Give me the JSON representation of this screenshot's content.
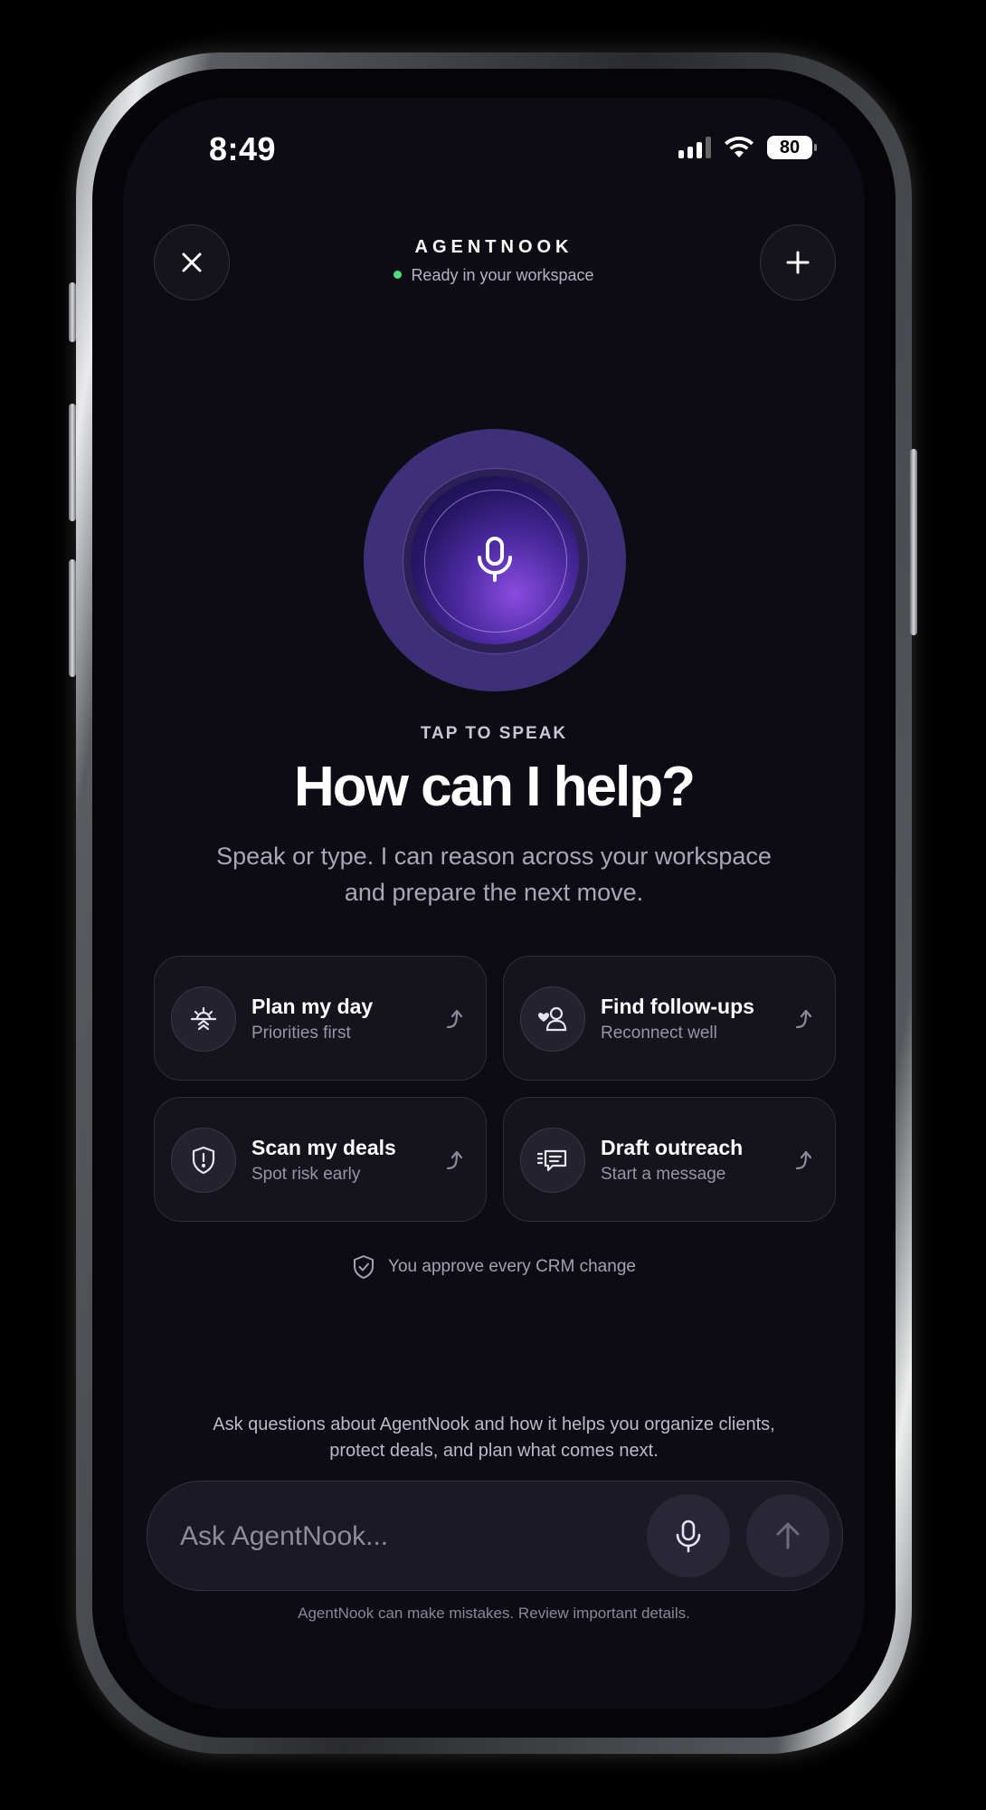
{
  "status_bar": {
    "time": "8:49",
    "battery": "80"
  },
  "header": {
    "title": "AGENTNOOK",
    "status": "Ready in your workspace"
  },
  "voice": {
    "tap_label": "TAP TO SPEAK"
  },
  "hero": {
    "headline": "How can I help?",
    "subtitle": "Speak or type. I can reason across your workspace and prepare the next move."
  },
  "suggestions": [
    {
      "title": "Plan my day",
      "subtitle": "Priorities first",
      "icon": "sunrise-icon"
    },
    {
      "title": "Find follow-ups",
      "subtitle": "Reconnect well",
      "icon": "heart-person-icon"
    },
    {
      "title": "Scan my deals",
      "subtitle": "Spot risk early",
      "icon": "shield-alert-icon"
    },
    {
      "title": "Draft outreach",
      "subtitle": "Start a message",
      "icon": "message-lines-icon"
    }
  ],
  "approval_note": "You approve every CRM change",
  "info_text": "Ask questions about AgentNook and how it helps you organize clients, protect deals, and plan what comes next.",
  "composer": {
    "placeholder": "Ask AgentNook..."
  },
  "disclaimer": "AgentNook can make mistakes. Review important details.",
  "colors": {
    "accent": "#3e3078",
    "status_dot": "#4ade80",
    "background": "#0d0c14"
  }
}
